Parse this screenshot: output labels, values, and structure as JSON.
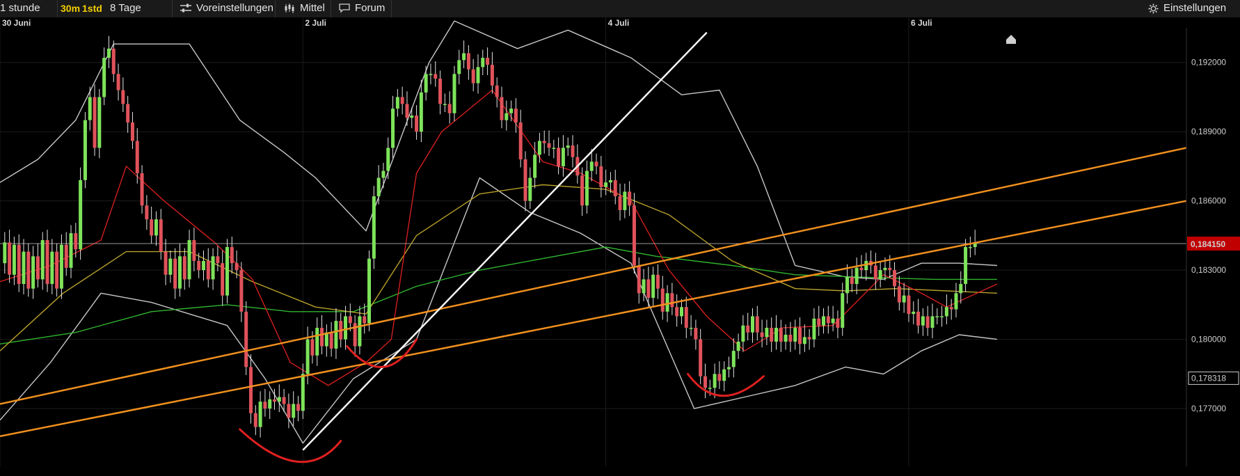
{
  "toolbar": {
    "interval_label": "1 stunde",
    "period_30m": "30m",
    "period_1std": "1std",
    "range_label": "8 Tage",
    "presets_label": "Voreinstellungen",
    "indicators_label": "Mittel",
    "forum_label": "Forum",
    "settings_label": "Einstellungen"
  },
  "icons": {
    "presets": "sliders-icon",
    "indicators": "candlestick-icon",
    "forum": "speech-bubble-icon",
    "settings": "gear-icon"
  },
  "colors": {
    "background": "#000000",
    "grid": "#1c1c1c",
    "up_candle": "#7ee35a",
    "down_candle": "#e0525a",
    "ma_fast": "#d21e1e",
    "ma_mid": "#b8a02a",
    "ma_slow": "#2fb52f",
    "bollinger": "#c8c8c8",
    "trend_orange": "#f0901e",
    "trend_white": "#f4f4f4",
    "marks_red": "#e02020",
    "price_badge": "#c00000",
    "period_highlight": "#f4d000"
  },
  "chart_data": {
    "type": "candlestick",
    "x_axis": {
      "labels": [
        {
          "text": "30 Juni",
          "hour": 0
        },
        {
          "text": "2 Juli",
          "hour": 48
        },
        {
          "text": "4 Juli",
          "hour": 96
        },
        {
          "text": "6 Juli",
          "hour": 144
        }
      ],
      "range_hours": [
        0,
        188
      ]
    },
    "y_axis": {
      "range": [
        0.1745,
        0.1935
      ],
      "ticks": [
        "0,192000",
        "0,189000",
        "0,186000",
        "0,183000",
        "0,180000",
        "0,177000"
      ],
      "tick_values": [
        0.192,
        0.189,
        0.186,
        0.183,
        0.18,
        0.177
      ]
    },
    "current_price_label": "0,184150",
    "current_price": 0.18415,
    "reference_price_label": "0,178318",
    "reference_price": 0.178318,
    "candle_closes": [
      0.1833,
      0.1842,
      0.1828,
      0.1841,
      0.1824,
      0.1838,
      0.1822,
      0.1836,
      0.1826,
      0.1843,
      0.1824,
      0.1838,
      0.1822,
      0.1841,
      0.1831,
      0.1846,
      0.1839,
      0.1869,
      0.1895,
      0.1905,
      0.1883,
      0.1905,
      0.1922,
      0.1926,
      0.1915,
      0.1908,
      0.1902,
      0.1894,
      0.1886,
      0.1872,
      0.1858,
      0.1852,
      0.1845,
      0.1852,
      0.1838,
      0.1828,
      0.1835,
      0.1822,
      0.1836,
      0.1826,
      0.1843,
      0.1834,
      0.183,
      0.1834,
      0.1826,
      0.1836,
      0.1833,
      0.1819,
      0.184,
      0.1833,
      0.183,
      0.1812,
      0.1788,
      0.1768,
      0.1762,
      0.1773,
      0.177,
      0.1774,
      0.1773,
      0.1775,
      0.1772,
      0.1766,
      0.1772,
      0.1769,
      0.1785,
      0.18,
      0.1793,
      0.1805,
      0.1797,
      0.1803,
      0.1796,
      0.1808,
      0.18,
      0.181,
      0.1807,
      0.1797,
      0.181,
      0.1807,
      0.1835,
      0.1862,
      0.187,
      0.1873,
      0.1883,
      0.19,
      0.1905,
      0.1902,
      0.1896,
      0.1897,
      0.189,
      0.1907,
      0.1915,
      0.1915,
      0.1913,
      0.1902,
      0.1902,
      0.1898,
      0.1915,
      0.1921,
      0.1924,
      0.1917,
      0.1911,
      0.1918,
      0.1922,
      0.1919,
      0.191,
      0.1905,
      0.1895,
      0.1898,
      0.19,
      0.1894,
      0.1878,
      0.186,
      0.187,
      0.188,
      0.1886,
      0.1885,
      0.1883,
      0.1883,
      0.1875,
      0.1883,
      0.1884,
      0.1879,
      0.1871,
      0.1858,
      0.1873,
      0.1877,
      0.1875,
      0.1866,
      0.1868,
      0.1869,
      0.1862,
      0.1856,
      0.1864,
      0.1858,
      0.1832,
      0.182,
      0.1826,
      0.1818,
      0.1828,
      0.1822,
      0.1812,
      0.182,
      0.1814,
      0.181,
      0.1814,
      0.1805,
      0.1805,
      0.18,
      0.1784,
      0.1779,
      0.1779,
      0.1785,
      0.1782,
      0.1787,
      0.1788,
      0.1795,
      0.1799,
      0.1806,
      0.1803,
      0.181,
      0.1803,
      0.1801,
      0.1805,
      0.1799,
      0.1805,
      0.1799,
      0.1802,
      0.1799,
      0.1805,
      0.1798,
      0.1801,
      0.18,
      0.1809,
      0.1806,
      0.181,
      0.1807,
      0.1809,
      0.1805,
      0.182,
      0.1827,
      0.1824,
      0.1831,
      0.183,
      0.1834,
      0.1832,
      0.1826,
      0.183,
      0.1831,
      0.183,
      0.1823,
      0.1816,
      0.1819,
      0.1811,
      0.1812,
      0.1806,
      0.181,
      0.1805,
      0.181,
      0.181,
      0.181,
      0.1814,
      0.1813,
      0.182,
      0.1824,
      0.184,
      0.184,
      0.1842
    ],
    "overlays": {
      "bollinger_upper": [
        [
          0,
          0.1868
        ],
        [
          6,
          0.1878
        ],
        [
          12,
          0.1895
        ],
        [
          18,
          0.1928
        ],
        [
          30,
          0.1928
        ],
        [
          38,
          0.1895
        ],
        [
          45,
          0.1881
        ],
        [
          50,
          0.187
        ],
        [
          58,
          0.1847
        ],
        [
          68,
          0.192
        ],
        [
          72,
          0.1938
        ],
        [
          82,
          0.1926
        ],
        [
          90,
          0.1934
        ],
        [
          100,
          0.1922
        ],
        [
          108,
          0.1906
        ],
        [
          114,
          0.1908
        ],
        [
          120,
          0.1875
        ],
        [
          126,
          0.1832
        ],
        [
          134,
          0.1827
        ],
        [
          140,
          0.1826
        ],
        [
          146,
          0.1833
        ],
        [
          152,
          0.1833
        ],
        [
          158,
          0.1832
        ]
      ],
      "bollinger_lower": [
        [
          0,
          0.1765
        ],
        [
          8,
          0.179
        ],
        [
          16,
          0.182
        ],
        [
          24,
          0.1816
        ],
        [
          36,
          0.1806
        ],
        [
          42,
          0.1783
        ],
        [
          48,
          0.1755
        ],
        [
          56,
          0.1783
        ],
        [
          66,
          0.18
        ],
        [
          76,
          0.187
        ],
        [
          84,
          0.1855
        ],
        [
          92,
          0.1846
        ],
        [
          100,
          0.1833
        ],
        [
          110,
          0.177
        ],
        [
          118,
          0.1775
        ],
        [
          126,
          0.178
        ],
        [
          134,
          0.1788
        ],
        [
          140,
          0.1785
        ],
        [
          146,
          0.1795
        ],
        [
          152,
          0.1802
        ],
        [
          158,
          0.18
        ]
      ],
      "ma_fast": [
        [
          0,
          0.1825
        ],
        [
          8,
          0.1832
        ],
        [
          16,
          0.1843
        ],
        [
          20,
          0.1875
        ],
        [
          26,
          0.186
        ],
        [
          34,
          0.1842
        ],
        [
          40,
          0.1826
        ],
        [
          46,
          0.179
        ],
        [
          52,
          0.178
        ],
        [
          58,
          0.179
        ],
        [
          62,
          0.18
        ],
        [
          66,
          0.1872
        ],
        [
          70,
          0.189
        ],
        [
          78,
          0.1908
        ],
        [
          86,
          0.1877
        ],
        [
          92,
          0.1872
        ],
        [
          100,
          0.186
        ],
        [
          106,
          0.183
        ],
        [
          112,
          0.181
        ],
        [
          118,
          0.1795
        ],
        [
          124,
          0.1805
        ],
        [
          132,
          0.1806
        ],
        [
          140,
          0.1828
        ],
        [
          146,
          0.182
        ],
        [
          150,
          0.1814
        ],
        [
          158,
          0.1824
        ]
      ],
      "ma_mid": [
        [
          0,
          0.1795
        ],
        [
          10,
          0.182
        ],
        [
          20,
          0.1838
        ],
        [
          30,
          0.1838
        ],
        [
          40,
          0.1825
        ],
        [
          50,
          0.1814
        ],
        [
          58,
          0.1811
        ],
        [
          66,
          0.1845
        ],
        [
          76,
          0.1863
        ],
        [
          86,
          0.1867
        ],
        [
          96,
          0.1865
        ],
        [
          106,
          0.1854
        ],
        [
          116,
          0.1834
        ],
        [
          126,
          0.1822
        ],
        [
          134,
          0.1821
        ],
        [
          142,
          0.1822
        ],
        [
          150,
          0.1821
        ],
        [
          158,
          0.182
        ]
      ],
      "ma_slow": [
        [
          0,
          0.1798
        ],
        [
          12,
          0.1803
        ],
        [
          24,
          0.1812
        ],
        [
          36,
          0.1815
        ],
        [
          46,
          0.1812
        ],
        [
          56,
          0.1812
        ],
        [
          66,
          0.1823
        ],
        [
          76,
          0.183
        ],
        [
          86,
          0.1835
        ],
        [
          96,
          0.184
        ],
        [
          104,
          0.1836
        ],
        [
          116,
          0.1832
        ],
        [
          126,
          0.1828
        ],
        [
          136,
          0.1827
        ],
        [
          148,
          0.1826
        ],
        [
          158,
          0.1826
        ]
      ]
    },
    "trendlines": [
      {
        "type": "orange",
        "from": [
          0,
          0.1758
        ],
        "to": [
          188,
          0.186
        ]
      },
      {
        "type": "orange",
        "from": [
          0,
          0.1772
        ],
        "to": [
          188,
          0.1883
        ]
      },
      {
        "type": "white",
        "from": [
          48,
          0.1752
        ],
        "to": [
          112,
          0.1933
        ]
      }
    ],
    "marks": [
      {
        "type": "red-curve",
        "from": [
          38,
          0.1761
        ],
        "mid": [
          48,
          0.1741
        ],
        "to": [
          54,
          0.1756
        ]
      },
      {
        "type": "red-curve",
        "from": [
          55,
          0.1797
        ],
        "mid": [
          61,
          0.1783
        ],
        "to": [
          66,
          0.18
        ]
      },
      {
        "type": "red-curve",
        "from": [
          109,
          0.1785
        ],
        "mid": [
          114,
          0.1772
        ],
        "to": [
          121,
          0.1784
        ]
      }
    ],
    "grid": true,
    "legend": "none"
  }
}
